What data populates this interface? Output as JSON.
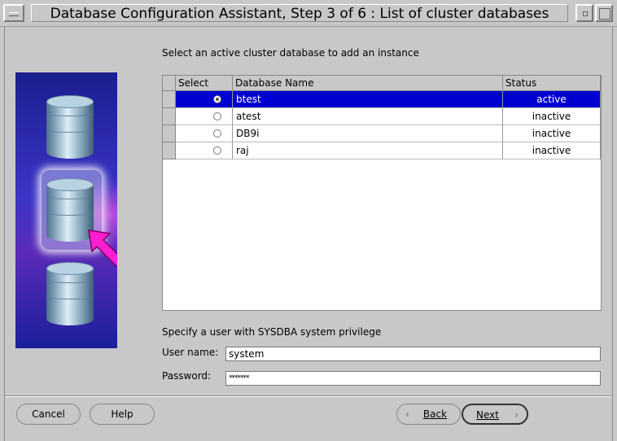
{
  "window": {
    "title": "Database Configuration Assistant, Step 3 of 6 : List of cluster databases"
  },
  "instruction": "Select an active cluster database to add an instance",
  "table": {
    "columns": [
      "Select",
      "Database Name",
      "Status"
    ],
    "rows": [
      {
        "name": "btest",
        "status": "active",
        "selected": true
      },
      {
        "name": "atest",
        "status": "inactive",
        "selected": false
      },
      {
        "name": "DB9i",
        "status": "inactive",
        "selected": false
      },
      {
        "name": "raj",
        "status": "inactive",
        "selected": false
      }
    ],
    "selection_color": "#0000d0"
  },
  "credentials": {
    "prompt": "Specify a user with SYSDBA system privilege",
    "username_label": "User name:",
    "username_value": "system",
    "password_label": "Password:",
    "password_value": "*******"
  },
  "buttons": {
    "cancel": "Cancel",
    "help": "Help",
    "back": "Back",
    "next": "Next"
  },
  "icons": {
    "back": "chevron-left-icon",
    "next": "chevron-right-icon",
    "pointer": "arrow-pointer-icon"
  }
}
